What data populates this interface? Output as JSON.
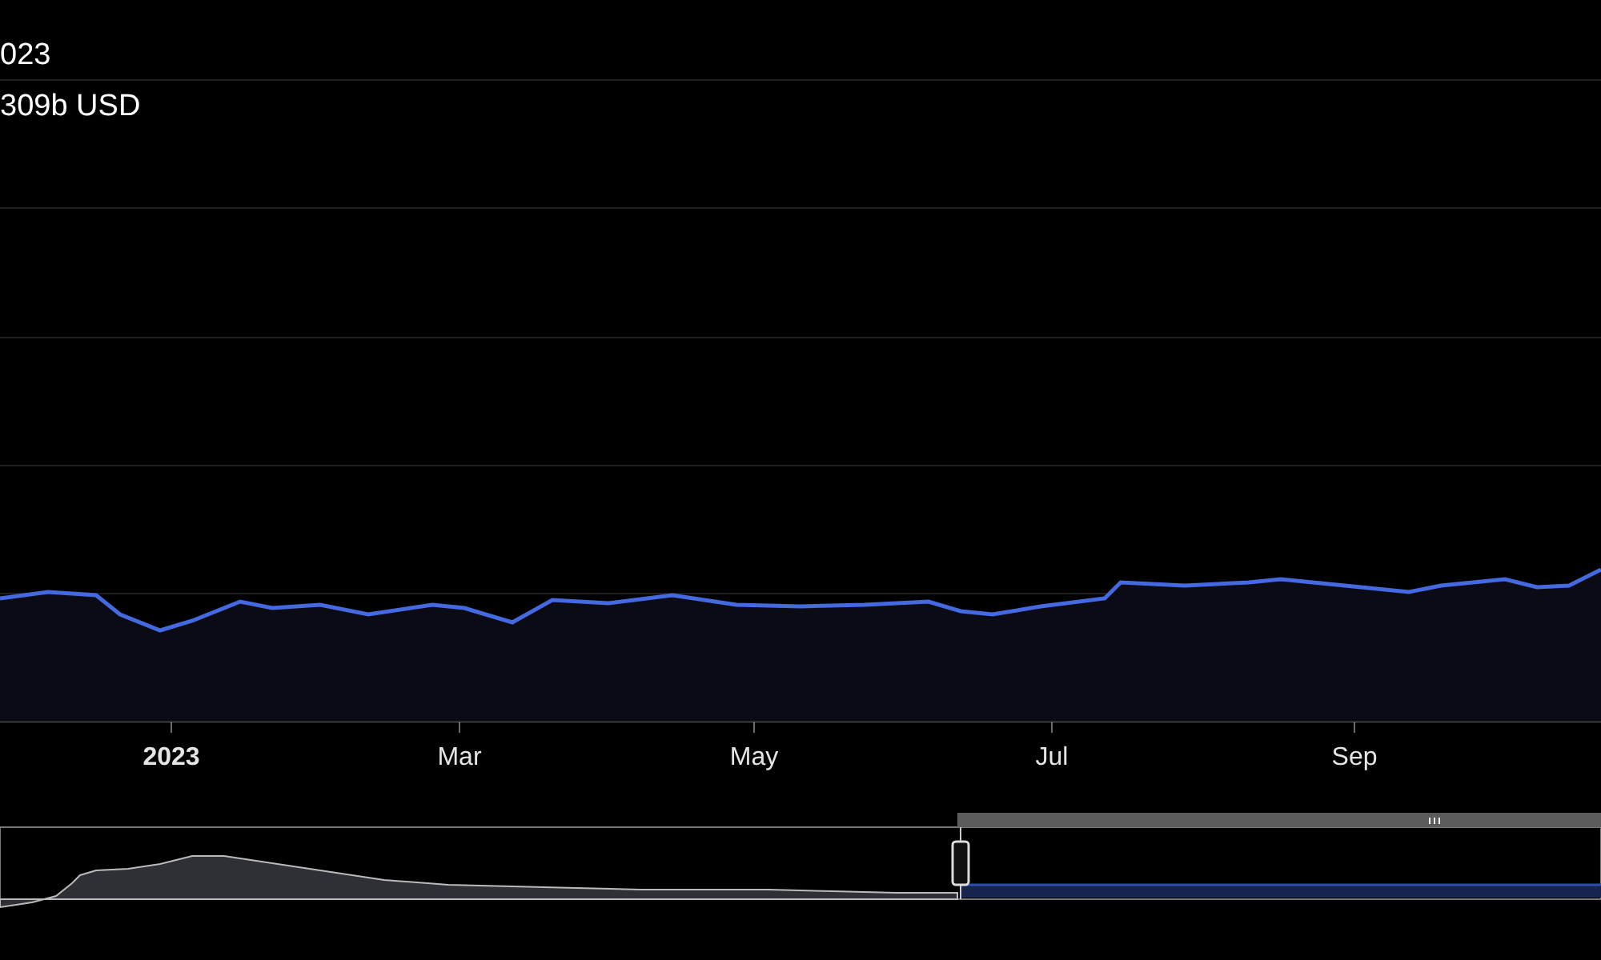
{
  "tooltip": {
    "date": "023",
    "value": "309b USD"
  },
  "x_axis": {
    "labels": [
      {
        "text": "2023",
        "bold": true
      },
      {
        "text": "Mar",
        "bold": false
      },
      {
        "text": "May",
        "bold": false
      },
      {
        "text": "Jul",
        "bold": false
      },
      {
        "text": "Sep",
        "bold": false
      }
    ]
  }
}
